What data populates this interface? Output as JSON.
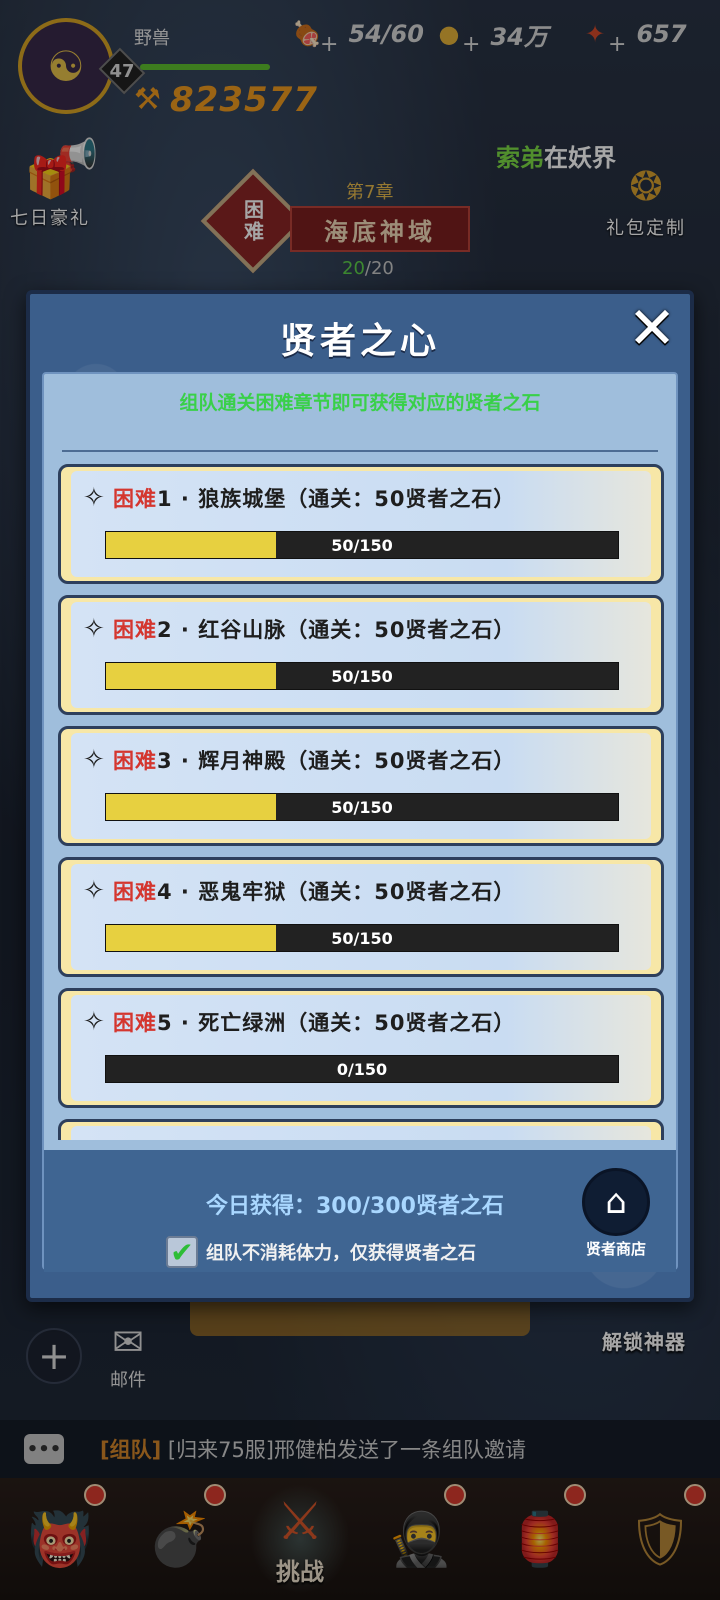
{
  "hud": {
    "player_name": "野兽",
    "level": "47",
    "power": "823577",
    "resources": [
      {
        "icon": "meat-icon",
        "value": "54/60"
      },
      {
        "icon": "gold-coin-icon",
        "value": "34万"
      },
      {
        "icon": "gem-icon",
        "value": "657"
      }
    ],
    "ticker": {
      "name": "索弟",
      "rest": "在妖界"
    }
  },
  "side_buttons": {
    "left": "七日豪礼",
    "right": "礼包定制"
  },
  "chapter": {
    "number": "第7章",
    "difficulty": "困难",
    "name": "海底神域",
    "progress_current": "20",
    "progress_total": "/20"
  },
  "modal": {
    "title": "贤者之心",
    "close_label": "✕",
    "subtitle": "组队通关困难章节即可获得对应的贤者之石",
    "items": [
      {
        "tag": "困难",
        "rest": "1 · 狼族城堡（通关：50贤者之石）",
        "progress_text": "50/150",
        "fraction": 0.333
      },
      {
        "tag": "困难",
        "rest": "2 · 红谷山脉（通关：50贤者之石）",
        "progress_text": "50/150",
        "fraction": 0.333
      },
      {
        "tag": "困难",
        "rest": "3 · 辉月神殿（通关：50贤者之石）",
        "progress_text": "50/150",
        "fraction": 0.333
      },
      {
        "tag": "困难",
        "rest": "4 · 恶鬼牢狱（通关：50贤者之石）",
        "progress_text": "50/150",
        "fraction": 0.333
      },
      {
        "tag": "困难",
        "rest": "5 · 死亡绿洲（通关：50贤者之石）",
        "progress_text": "0/150",
        "fraction": 0.0
      }
    ],
    "today_text": "今日获得：300/300贤者之石",
    "checkbox_checked": true,
    "checkbox_label": "组队不消耗体力，仅获得贤者之石",
    "shop_label": "贤者商店"
  },
  "bottom": {
    "mail_label": "邮件",
    "unlock_label": "解锁神器",
    "chat_tag": "[组队]",
    "chat_text": "[归来75服]邢健柏发送了一条组队邀请",
    "chat_icon": "•••",
    "nav": [
      {
        "icon": "demon-mask-icon",
        "label": "",
        "dot": true
      },
      {
        "icon": "cannon-icon",
        "label": "",
        "dot": true
      },
      {
        "icon": "crossed-swords-icon",
        "label": "挑战",
        "dot": false,
        "active": true
      },
      {
        "icon": "warrior-icon",
        "label": "",
        "dot": true
      },
      {
        "icon": "lantern-icon",
        "label": "",
        "dot": true
      },
      {
        "icon": "shield-icon",
        "label": "",
        "dot": true
      }
    ]
  },
  "colors": {
    "hard_red": "#d4362f",
    "progress_yellow": "#e7d040",
    "subtitle_green": "#39d049"
  }
}
